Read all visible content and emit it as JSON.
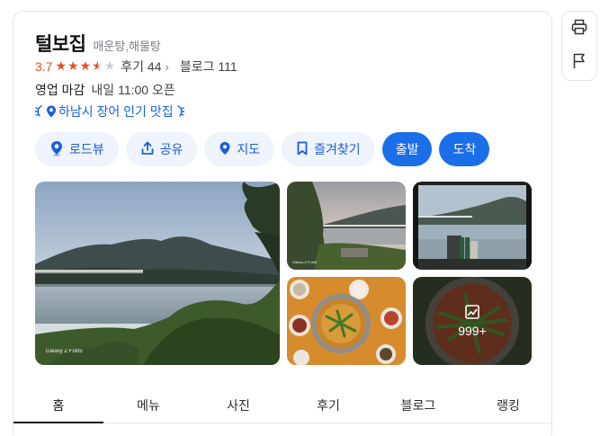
{
  "place": {
    "name": "털보집",
    "category": "매운탕,해물탕",
    "rating": "3.7",
    "stars": {
      "full": 3,
      "half": 1,
      "empty": 1
    },
    "reviews_label": "후기 44",
    "blog_label": "블로그 111",
    "hours_status": "영업 마감",
    "hours_next": "내일 11:00 오픈",
    "tag": "하남시 장어 인기 맛집"
  },
  "actions": {
    "roadview": "로드뷰",
    "share": "공유",
    "map": "지도",
    "favorite": "즐겨찾기",
    "depart": "출발",
    "arrive": "도착"
  },
  "photos": {
    "watermark": "Galaxy Z Fold5",
    "more_count": "999+"
  },
  "tabs": [
    "홈",
    "메뉴",
    "사진",
    "후기",
    "블로그",
    "랭킹"
  ],
  "active_tab": 0,
  "colors": {
    "accent": "#1a6ee8",
    "link": "#1a5fd7",
    "star": "#e8501e",
    "pill_bg": "#eef3fc"
  },
  "icons": {
    "side": [
      "print-icon",
      "flag-icon"
    ],
    "actions": [
      "roadview-pin-icon",
      "share-icon",
      "map-pin-icon",
      "bookmark-icon"
    ]
  }
}
